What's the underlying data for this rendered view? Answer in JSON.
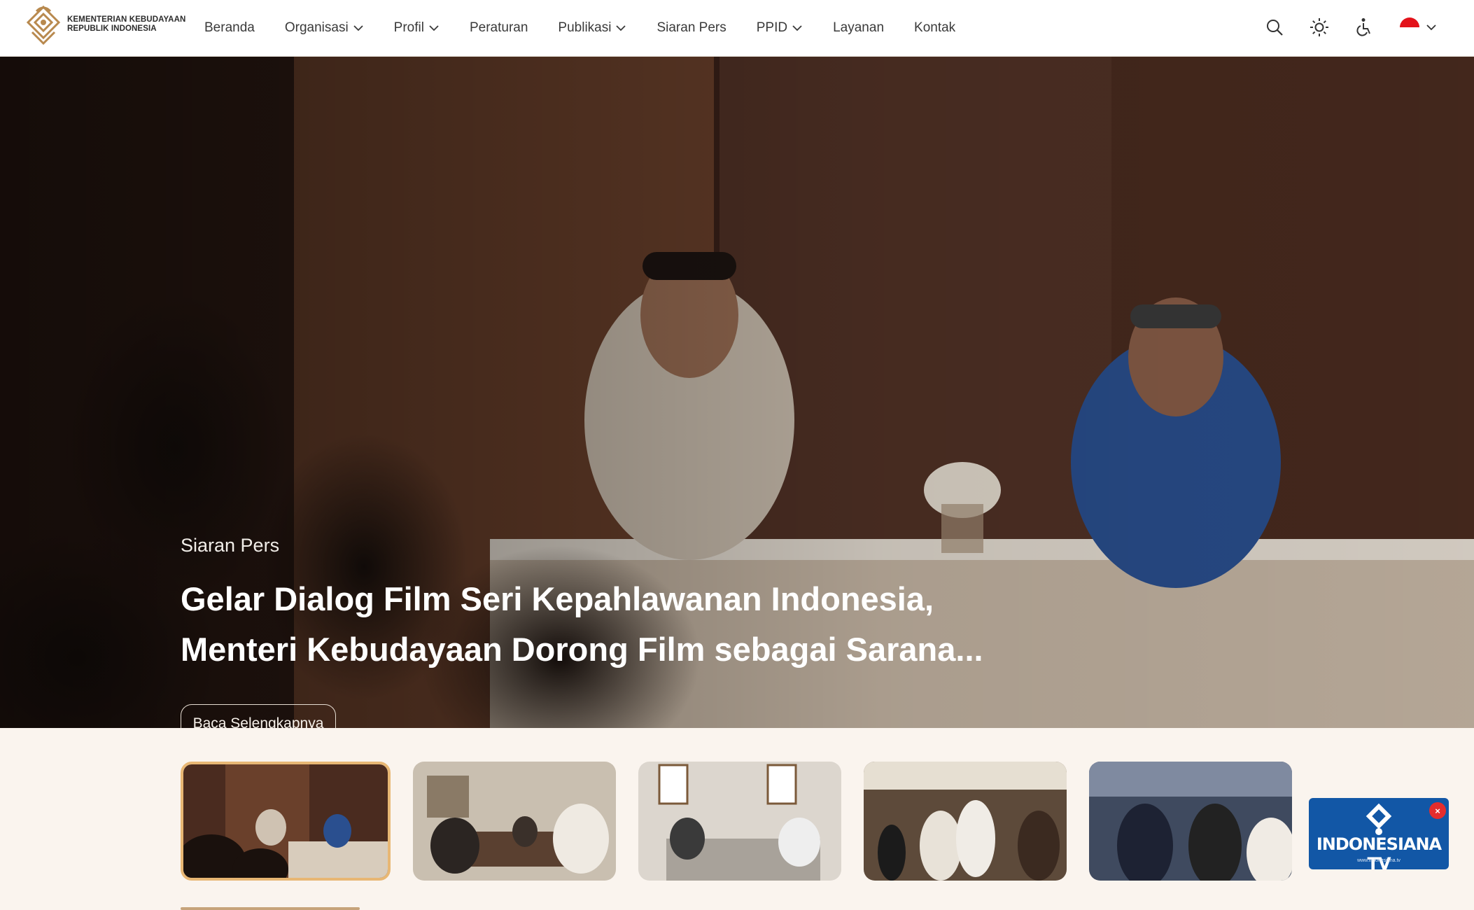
{
  "header": {
    "logo_line1": "KEMENTERIAN KEBUDAYAAN",
    "logo_line2": "REPUBLIK INDONESIA",
    "nav": [
      {
        "label": "Beranda",
        "has_dropdown": false
      },
      {
        "label": "Organisasi",
        "has_dropdown": true
      },
      {
        "label": "Profil",
        "has_dropdown": true
      },
      {
        "label": "Peraturan",
        "has_dropdown": false
      },
      {
        "label": "Publikasi",
        "has_dropdown": true
      },
      {
        "label": "Siaran Pers",
        "has_dropdown": false
      },
      {
        "label": "PPID",
        "has_dropdown": true
      },
      {
        "label": "Layanan",
        "has_dropdown": false
      },
      {
        "label": "Kontak",
        "has_dropdown": false
      }
    ],
    "tools": [
      "search-icon",
      "sun-icon",
      "accessibility-icon",
      "indonesia-flag-icon"
    ]
  },
  "hero": {
    "category": "Siaran Pers",
    "title_line1": "Gelar Dialog Film Seri Kepahlawanan Indonesia,",
    "title_line2": "Menteri Kebudayaan Dorong Film sebagai Sarana...",
    "button": "Baca Selengkapnya"
  },
  "thumbnails": {
    "count": 5,
    "active_index": 0
  },
  "ad": {
    "brand": "INDONESIANA TV",
    "url": "www.indonesiana.tv",
    "close": "×"
  },
  "colors": {
    "accent": "#e8b774",
    "ad_blue": "#1257a6",
    "page_bg": "#faf4ee"
  }
}
